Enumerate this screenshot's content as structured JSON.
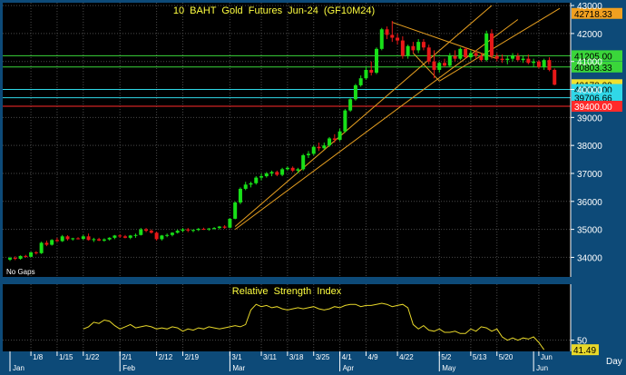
{
  "chart_data": [
    {
      "type": "candlestick",
      "title": "10  BAHT  Gold  Futures  Jun-24  (GF10M24)",
      "note": "No Gaps",
      "ylim": [
        33300,
        43100
      ],
      "yticks": [
        34000,
        35000,
        36000,
        37000,
        38000,
        39000,
        40000,
        41000,
        42000,
        43000
      ],
      "x_range": [
        0,
        105
      ],
      "price_lines": [
        {
          "label": "42718.33",
          "value": 42718.33,
          "line": false,
          "color": "#f0a020",
          "text_color": "#000000"
        },
        {
          "label": "41205.00",
          "value": 41205,
          "line": true,
          "color": "#3ad63a",
          "text_color": "#000000"
        },
        {
          "label": "40803.33",
          "value": 40803.33,
          "line": true,
          "color": "#3ad63a",
          "text_color": "#000000"
        },
        {
          "label": "40170.00",
          "value": 40170,
          "line": false,
          "color": "#f0e030",
          "text_color": "#000000"
        },
        {
          "label": "40000.00",
          "value": 40000,
          "line": true,
          "color": "#30d8e8",
          "text_color": "#000000"
        },
        {
          "label": "39706.66",
          "value": 39706.66,
          "line": true,
          "color": "#30d8e8",
          "text_color": "#000000"
        },
        {
          "label": "39400.00",
          "value": 39400,
          "line": true,
          "color": "#ff2a2a",
          "text_color": "#ffffff"
        }
      ],
      "trendlines": [
        {
          "x1": 43,
          "y1": 35100,
          "x2": 92,
          "y2": 43000
        },
        {
          "x1": 43,
          "y1": 35000,
          "x2": 97,
          "y2": 42500
        },
        {
          "x1": 73,
          "y1": 42400,
          "x2": 93,
          "y2": 41100
        },
        {
          "x1": 82,
          "y1": 40300,
          "x2": 105,
          "y2": 42900
        },
        {
          "x1": 82,
          "y1": 40300,
          "x2": 77,
          "y2": 41300
        }
      ],
      "candles": [
        [
          33920,
          34020,
          33870,
          33980
        ],
        [
          33980,
          34040,
          33900,
          33950
        ],
        [
          33950,
          34070,
          33920,
          34050
        ],
        [
          34050,
          34090,
          33990,
          34020
        ],
        [
          34020,
          34200,
          34000,
          34180
        ],
        [
          34180,
          34220,
          34100,
          34150
        ],
        [
          34150,
          34560,
          34120,
          34520
        ],
        [
          34520,
          34600,
          34400,
          34450
        ],
        [
          34450,
          34650,
          34420,
          34620
        ],
        [
          34620,
          34700,
          34550,
          34580
        ],
        [
          34580,
          34800,
          34550,
          34750
        ],
        [
          34750,
          34790,
          34600,
          34650
        ],
        [
          34650,
          34700,
          34600,
          34680
        ],
        [
          34680,
          34720,
          34640,
          34660
        ],
        [
          34660,
          34800,
          34620,
          34750
        ],
        [
          34750,
          34850,
          34600,
          34620
        ],
        [
          34620,
          34700,
          34550,
          34650
        ],
        [
          34650,
          34700,
          34580,
          34600
        ],
        [
          34600,
          34680,
          34560,
          34640
        ],
        [
          34640,
          34720,
          34600,
          34700
        ],
        [
          34700,
          34800,
          34650,
          34780
        ],
        [
          34780,
          34820,
          34700,
          34750
        ],
        [
          34750,
          34800,
          34680,
          34700
        ],
        [
          34700,
          34800,
          34650,
          34780
        ],
        [
          34780,
          34850,
          34700,
          34800
        ],
        [
          34800,
          35050,
          34780,
          35000
        ],
        [
          35000,
          35050,
          34900,
          34950
        ],
        [
          34950,
          35000,
          34850,
          34880
        ],
        [
          34880,
          34920,
          34600,
          34650
        ],
        [
          34650,
          34800,
          34600,
          34780
        ],
        [
          34780,
          34850,
          34720,
          34800
        ],
        [
          34800,
          34900,
          34750,
          34880
        ],
        [
          34880,
          35000,
          34850,
          34950
        ],
        [
          34950,
          35050,
          34900,
          35000
        ],
        [
          35000,
          35050,
          34900,
          34960
        ],
        [
          34960,
          35000,
          34900,
          34980
        ],
        [
          34980,
          35050,
          34940,
          35020
        ],
        [
          35020,
          35060,
          34980,
          35000
        ],
        [
          35000,
          35050,
          34950,
          35030
        ],
        [
          35030,
          35080,
          34990,
          35050
        ],
        [
          35050,
          35120,
          35000,
          35100
        ],
        [
          35100,
          35150,
          35020,
          35060
        ],
        [
          35060,
          35400,
          35040,
          35380
        ],
        [
          35380,
          36000,
          35360,
          35960
        ],
        [
          35960,
          36500,
          35900,
          36450
        ],
        [
          36450,
          36700,
          36400,
          36600
        ],
        [
          36600,
          36700,
          36500,
          36650
        ],
        [
          36650,
          36900,
          36600,
          36850
        ],
        [
          36850,
          37000,
          36750,
          36900
        ],
        [
          36900,
          37050,
          36850,
          37000
        ],
        [
          37000,
          37100,
          36900,
          37050
        ],
        [
          37050,
          37100,
          36900,
          36950
        ],
        [
          36950,
          37200,
          36900,
          37150
        ],
        [
          37150,
          37250,
          37100,
          37200
        ],
        [
          37200,
          37250,
          37050,
          37100
        ],
        [
          37100,
          37200,
          37000,
          37150
        ],
        [
          37150,
          37700,
          37100,
          37650
        ],
        [
          37650,
          37800,
          37550,
          37700
        ],
        [
          37700,
          38000,
          37650,
          37950
        ],
        [
          37950,
          38100,
          37800,
          37900
        ],
        [
          37900,
          38100,
          37850,
          38000
        ],
        [
          38000,
          38300,
          37950,
          38250
        ],
        [
          38250,
          38400,
          38100,
          38200
        ],
        [
          38200,
          38600,
          38150,
          38500
        ],
        [
          38500,
          39300,
          38450,
          39250
        ],
        [
          39250,
          39700,
          39200,
          39650
        ],
        [
          39650,
          40200,
          39600,
          40150
        ],
        [
          40150,
          40500,
          40100,
          40400
        ],
        [
          40400,
          40800,
          40350,
          40700
        ],
        [
          40700,
          41000,
          40500,
          40600
        ],
        [
          40600,
          41500,
          40550,
          41450
        ],
        [
          41450,
          42200,
          41400,
          42150
        ],
        [
          42150,
          42250,
          41800,
          41950
        ],
        [
          41950,
          42450,
          41700,
          41850
        ],
        [
          41850,
          42000,
          41600,
          41750
        ],
        [
          41750,
          41900,
          41100,
          41200
        ],
        [
          41200,
          41600,
          41100,
          41550
        ],
        [
          41550,
          41700,
          41300,
          41400
        ],
        [
          41400,
          41800,
          41300,
          41700
        ],
        [
          41700,
          41800,
          41400,
          41500
        ],
        [
          41500,
          41600,
          40900,
          41000
        ],
        [
          41000,
          41400,
          40400,
          40700
        ],
        [
          40700,
          41000,
          40600,
          40950
        ],
        [
          40950,
          41100,
          40800,
          40850
        ],
        [
          40850,
          41300,
          40800,
          41200
        ],
        [
          41200,
          41400,
          41000,
          41100
        ],
        [
          41100,
          41500,
          41050,
          41450
        ],
        [
          41450,
          41500,
          41100,
          41150
        ],
        [
          41150,
          41400,
          41050,
          41300
        ],
        [
          41300,
          41400,
          41100,
          41200
        ],
        [
          41200,
          41300,
          41000,
          41050
        ],
        [
          41050,
          42100,
          41000,
          42000
        ],
        [
          42000,
          42150,
          41100,
          41200
        ],
        [
          41200,
          41300,
          41000,
          41100
        ],
        [
          41100,
          41250,
          40950,
          41050
        ],
        [
          41050,
          41200,
          40900,
          41100
        ],
        [
          41100,
          41300,
          41000,
          41200
        ],
        [
          41200,
          41300,
          41000,
          41050
        ],
        [
          41050,
          41200,
          40950,
          41100
        ],
        [
          41100,
          41250,
          40900,
          40950
        ],
        [
          40950,
          41100,
          40800,
          41000
        ],
        [
          41000,
          41050,
          40750,
          40800
        ],
        [
          40800,
          41100,
          40700,
          41050
        ],
        [
          41050,
          41150,
          40650,
          40700
        ],
        [
          40700,
          40750,
          40150,
          40170
        ]
      ]
    },
    {
      "type": "line",
      "title": "Relative  Strength  Index",
      "ylim": [
        40,
        100
      ],
      "yticks": [
        50
      ],
      "last_label": "41.49",
      "series": [
        {
          "color": "#e8d82a",
          "start_index": 14,
          "values": [
            60,
            62,
            66,
            65,
            68,
            67,
            63,
            60,
            62,
            64,
            61,
            62,
            63,
            62,
            60,
            61,
            60,
            62,
            61,
            58,
            60,
            59,
            61,
            60,
            62,
            61,
            60,
            61,
            62,
            63,
            62,
            64,
            77,
            82,
            80,
            81,
            79,
            80,
            78,
            77,
            78,
            79,
            78,
            79,
            80,
            78,
            77,
            78,
            80,
            79,
            81,
            82,
            82,
            80,
            81,
            81,
            82,
            83,
            82,
            80,
            81,
            82,
            79,
            64,
            60,
            63,
            59,
            58,
            60,
            57,
            57,
            58,
            56,
            56,
            60,
            58,
            62,
            61,
            58,
            60,
            53,
            50,
            52,
            50,
            52,
            51,
            53,
            48,
            41.49
          ]
        }
      ]
    }
  ],
  "x_axis": {
    "ticks": [
      {
        "label": "1/8",
        "index": 4
      },
      {
        "label": "1/15",
        "index": 9
      },
      {
        "label": "1/22",
        "index": 14
      },
      {
        "label": "2/1",
        "index": 21
      },
      {
        "label": "2/12",
        "index": 28
      },
      {
        "label": "2/19",
        "index": 33
      },
      {
        "label": "3/1",
        "index": 42
      },
      {
        "label": "3/11",
        "index": 48
      },
      {
        "label": "3/18",
        "index": 53
      },
      {
        "label": "3/25",
        "index": 58
      },
      {
        "label": "4/1",
        "index": 63
      },
      {
        "label": "4/9",
        "index": 68
      },
      {
        "label": "4/22",
        "index": 74
      },
      {
        "label": "5/2",
        "index": 82
      },
      {
        "label": "5/13",
        "index": 88
      },
      {
        "label": "5/20",
        "index": 93
      },
      {
        "label": "Jun",
        "index": 101
      }
    ],
    "months": [
      {
        "label": "Jan",
        "index": 0
      },
      {
        "label": "Feb",
        "index": 21
      },
      {
        "label": "Mar",
        "index": 42
      },
      {
        "label": "Apr",
        "index": 63
      },
      {
        "label": "May",
        "index": 82
      },
      {
        "label": "Jun",
        "index": 100
      }
    ],
    "period": "Day"
  },
  "colors": {
    "background": "#000000",
    "frame": "#0d4a78",
    "grid": "#4a4a4a",
    "up": "#18e018",
    "down": "#e81818",
    "trendline": "#e8a020",
    "text": "#ffffff",
    "title": "#ffff40"
  }
}
